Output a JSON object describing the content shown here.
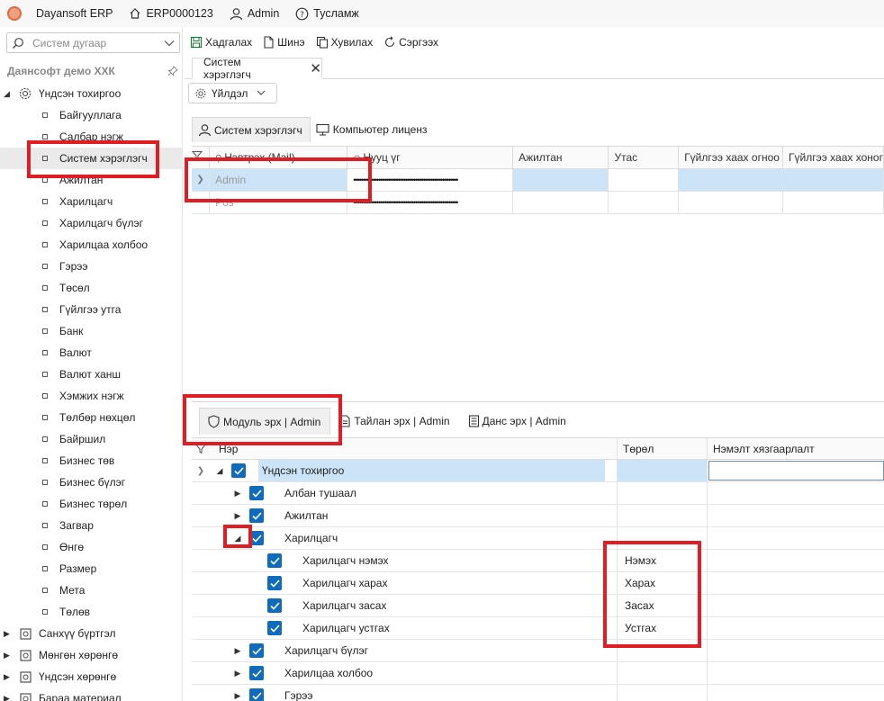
{
  "titlebar": {
    "app": "Dayansoft ERP",
    "instance": "ERP0000123",
    "user": "Admin",
    "help": "Тусламж"
  },
  "sidebar": {
    "search_placeholder": "Систем дугаар",
    "company": "Даянсофт демо ХХК",
    "root": "Үндсэн тохиргоо",
    "items": [
      "Байгууллага",
      "Салбар нэгж",
      "Систем хэрэглэгч",
      "Ажилтан",
      "Харилцагч",
      "Харилцагч бүлэг",
      "Харилцаа холбоо",
      "Гэрээ",
      "Төсөл",
      "Гүйлгээ утга",
      "Банк",
      "Валют",
      "Валют ханш",
      "Хэмжих нэгж",
      "Төлбөр нөхцөл",
      "Байршил",
      "Бизнес төв",
      "Бизнес бүлэг",
      "Бизнес төрөл",
      "Загвар",
      "Өнгө",
      "Размер",
      "Мета",
      "Төлөв"
    ],
    "groups": [
      "Санхүү бүртгэл",
      "Мөнгөн хөрөнгө",
      "Үндсэн хөрөнгө",
      "Бараа материал"
    ]
  },
  "toolbar": {
    "save": "Хадгалах",
    "new": "Шинэ",
    "copy": "Хувилах",
    "refresh": "Сэргээх"
  },
  "tab": {
    "title": "Систем хэрэглэгч"
  },
  "action": {
    "label": "Үйлдэл"
  },
  "subtabs": {
    "users": "Систем хэрэглэгч",
    "license": "Компьютер лиценз"
  },
  "user_grid": {
    "columns": [
      "Нэвтрэх (Mail)",
      "Нууц үг",
      "Ажилтан",
      "Утас",
      "Гүйлгээ хаах огноо",
      "Гүйлгээ хаах хоног"
    ],
    "rows": [
      {
        "login": "Admin",
        "password": "••••••••••••••••••••••••••••••••••••••••••••••••••••••"
      },
      {
        "login": "Pos",
        "password": "••••••••••••••••••••••••••••••••••••••••••••••••••••••"
      }
    ]
  },
  "perm_tabs": {
    "module": "Модуль эрх | Admin",
    "report": "Тайлан эрх | Admin",
    "account": "Данс эрх | Admin"
  },
  "perm_grid": {
    "columns": [
      "Нэр",
      "Төрөл",
      "Нэмэлт хязгаарлалт"
    ],
    "rows": [
      {
        "name": "Үндсэн тохиргоо",
        "type": ""
      },
      {
        "name": "Албан тушаал",
        "type": ""
      },
      {
        "name": "Ажилтан",
        "type": ""
      },
      {
        "name": "Харилцагч",
        "type": ""
      },
      {
        "name": "Харилцагч нэмэх",
        "type": "Нэмэх"
      },
      {
        "name": "Харилцагч харах",
        "type": "Харах"
      },
      {
        "name": "Харилцагч засах",
        "type": "Засах"
      },
      {
        "name": "Харилцагч устгах",
        "type": "Устгах"
      },
      {
        "name": "Харилцагч бүлэг",
        "type": ""
      },
      {
        "name": "Харилцаа холбоо",
        "type": ""
      },
      {
        "name": "Гэрээ",
        "type": ""
      }
    ]
  }
}
